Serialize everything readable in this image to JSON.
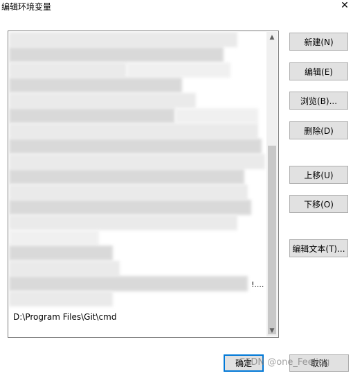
{
  "window": {
    "title": "编辑环境变量",
    "close_glyph": "✕"
  },
  "list": {
    "visible_entry": "D:\\Program Files\\Git\\cmd",
    "truncated_suffix": "!...."
  },
  "buttons": {
    "new": "新建(N)",
    "edit": "编辑(E)",
    "browse": "浏览(B)...",
    "delete": "删除(D)",
    "move_up": "上移(U)",
    "move_down": "下移(O)",
    "edit_text": "编辑文本(T)..."
  },
  "footer": {
    "ok": "确定",
    "cancel": "取消"
  },
  "watermark": {
    "text": "CSDN @one_Feeling"
  },
  "colors": {
    "focus_border": "#0078d7",
    "button_bg": "#e1e1e1"
  }
}
